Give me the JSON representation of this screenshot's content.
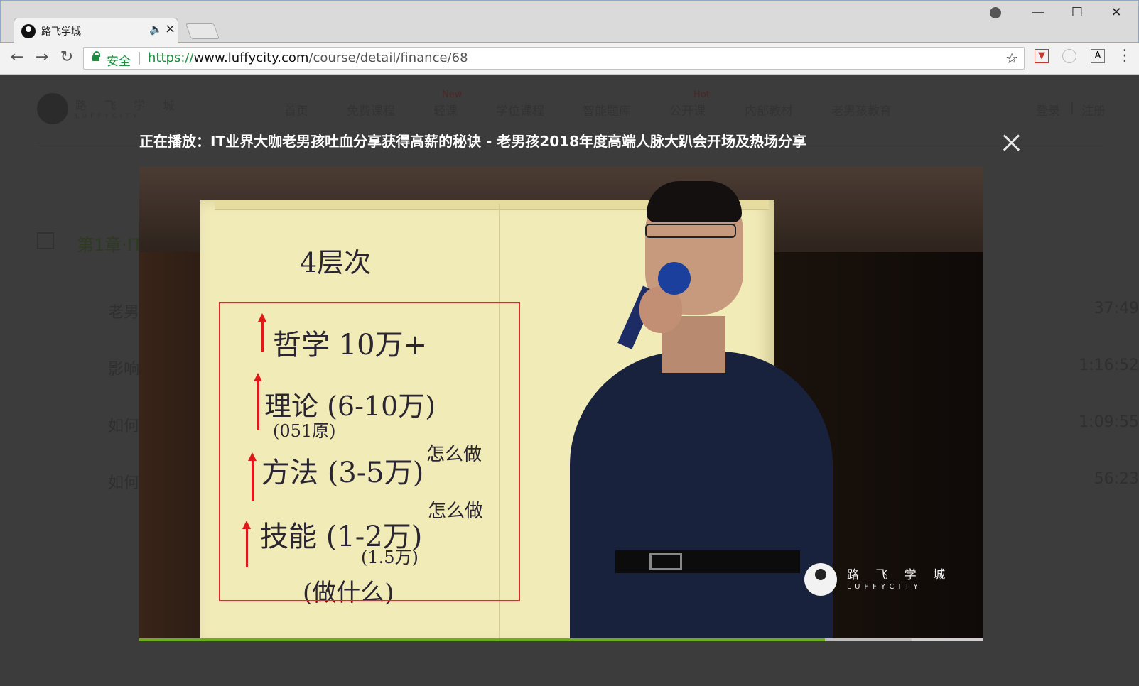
{
  "browser": {
    "tab_title": "路飞学城",
    "url_scheme": "https://",
    "url_host": "www.luffycity.com",
    "url_path": "/course/detail/finance/68",
    "secure_label": "安全"
  },
  "site": {
    "brand": "路 飞 学 城",
    "brand_en": "LUFFYCITY",
    "nav": [
      {
        "label": "首页",
        "badge": ""
      },
      {
        "label": "免费课程",
        "badge": ""
      },
      {
        "label": "轻课",
        "badge": "New"
      },
      {
        "label": "学位课程",
        "badge": ""
      },
      {
        "label": "智能题库",
        "badge": ""
      },
      {
        "label": "公开课",
        "badge": "Hot"
      },
      {
        "label": "内部教材",
        "badge": ""
      },
      {
        "label": "老男孩教育",
        "badge": ""
      }
    ],
    "login": "登录",
    "separator": "|",
    "register": "注册"
  },
  "chapter": {
    "title": "第1章·IT",
    "lessons": [
      {
        "title": "老男",
        "duration": "37:49"
      },
      {
        "title": "影响",
        "duration": "1:16:52"
      },
      {
        "title": "如何",
        "duration": "1:09:55"
      },
      {
        "title": "如何",
        "duration": "56:23"
      }
    ]
  },
  "modal": {
    "now_playing": "正在播放：IT业界大咖老男孩吐血分享获得高薪的秘诀 - 老男孩2018年度高端人脉大趴会开场及热场分享"
  },
  "video": {
    "handwriting": {
      "heading": "4层次",
      "line1": "哲学 10万+",
      "line2": "理论 (6-10万)",
      "line2b": "(051原)",
      "line3": "方法 (3-5万)",
      "line3_note": "怎么做",
      "line4": "技能 (1-2万)",
      "line4_note": "怎么做",
      "line4b": "(1.5万)",
      "line5": "(做什么)"
    },
    "watermark_brand": "路 飞 学 城",
    "watermark_en": "LUFFYCITY",
    "progress": 0.812,
    "buffered": 0.915,
    "progress_color": "#6dab1f",
    "annotation_color": "#e02a2a"
  }
}
